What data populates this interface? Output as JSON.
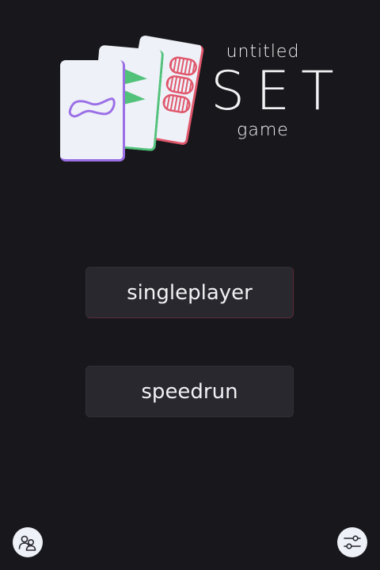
{
  "logo": {
    "line1": "untitled",
    "line2": "SET",
    "line3": "game",
    "cards": [
      {
        "shape": "squiggle",
        "count": 1,
        "fill": "empty",
        "color": "#9b6ee6"
      },
      {
        "shape": "diamond",
        "count": 2,
        "fill": "solid",
        "color": "#52c27a"
      },
      {
        "shape": "oval",
        "count": 3,
        "fill": "striped",
        "color": "#e0566b"
      }
    ]
  },
  "menu": {
    "singleplayer_label": "singleplayer",
    "speedrun_label": "speedrun"
  },
  "footer": {
    "left_icon": "multiplayer-users-icon",
    "right_icon": "settings-sliders-icon"
  },
  "colors": {
    "background": "#18181c",
    "button": "#28282e",
    "card": "#eef1f8",
    "purple": "#9b6ee6",
    "green": "#52c27a",
    "red": "#e0566b"
  }
}
